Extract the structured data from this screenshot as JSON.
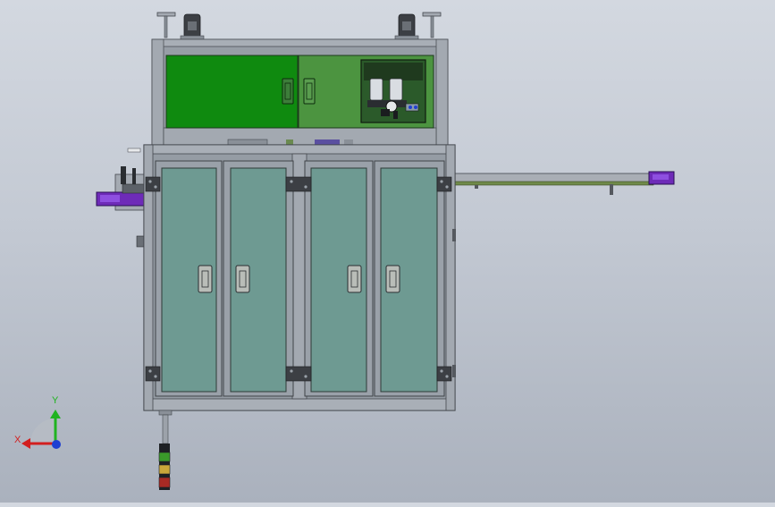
{
  "viewport": {
    "background_top": "#d3d8e0",
    "background_bottom": "#aab1bd",
    "content": "front-view-machine-cad-model"
  },
  "colors": {
    "frame": "#8f969e",
    "frame_dark": "#55595f",
    "door_glass": "#6e9a92",
    "upper_panel_left": "#0f8a0f",
    "upper_panel_right": "#4c9440",
    "conveyor_accent": "#6e2bb8",
    "signal_green": "#3a9a2a",
    "signal_yellow": "#c9a63a",
    "signal_red": "#a82a24"
  },
  "axis_triad": {
    "x_label": "X",
    "y_label": "Y",
    "x_color": "#d21f1f",
    "y_color": "#1fb31f",
    "z_color": "#1f3fd2"
  }
}
